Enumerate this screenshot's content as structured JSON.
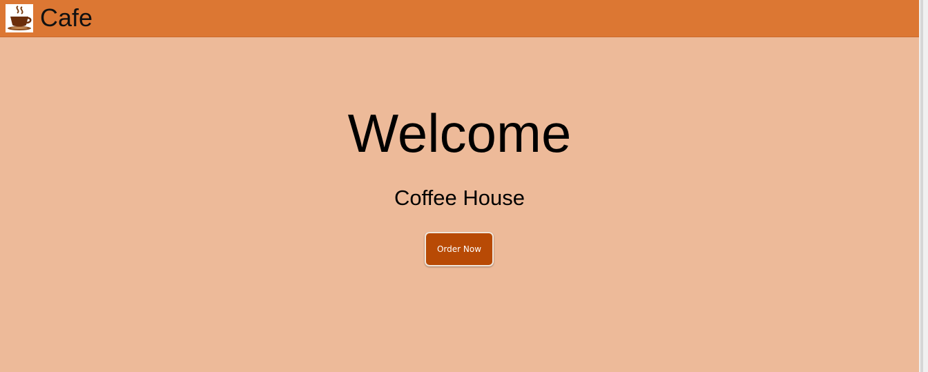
{
  "navbar": {
    "brand": "Cafe",
    "logo_icon": "coffee-cup-icon",
    "color": "#dc7733"
  },
  "hero": {
    "title": "Welcome",
    "subtitle": "Coffee House",
    "background": "#edba99",
    "cta_label": "Order Now",
    "cta_color": "#b84a05"
  }
}
